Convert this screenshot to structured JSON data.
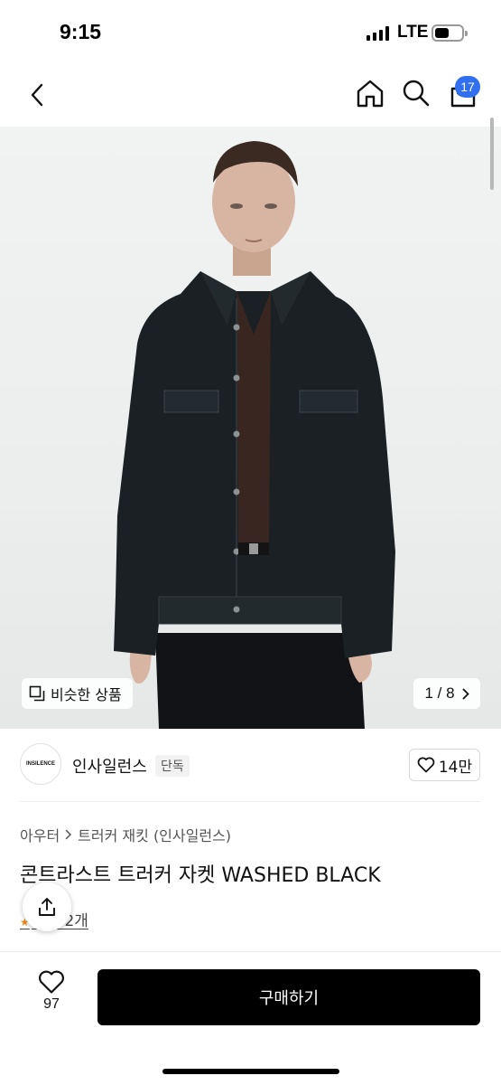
{
  "status_bar": {
    "time": "9:15",
    "network": "LTE",
    "battery_level": 0.55
  },
  "nav": {
    "back_icon": "chevron-left-icon",
    "home_icon": "home-icon",
    "search_icon": "search-icon",
    "cart_icon": "shopping-bag-icon",
    "cart_badge": "17",
    "badge_color": "#2f6ff0"
  },
  "product_image": {
    "similar_button_label": "비슷한 상품",
    "page_counter": "1 / 8"
  },
  "brand": {
    "logo_text": "INSILENCE",
    "name": "인사일런스",
    "tag": "단독",
    "like_count": "14만"
  },
  "breadcrumb": {
    "category": "아우터",
    "subcategory": "트러커 재킷 (인사일런스)"
  },
  "product": {
    "title": "콘트라스트 트러커 자켓 WASHED BLACK",
    "review_text": "후기 2개"
  },
  "bottom_bar": {
    "heart_count": "97",
    "buy_label": "구매하기"
  }
}
